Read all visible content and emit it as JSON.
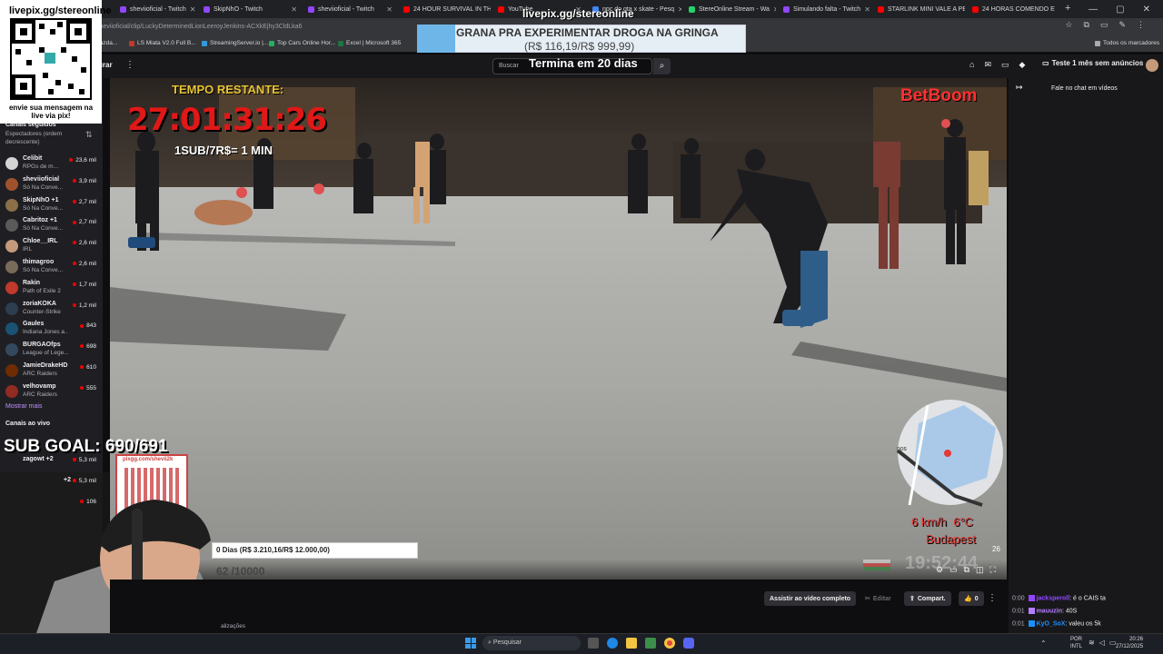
{
  "browser": {
    "tabs": [
      {
        "label": "sheviioficial - Twitch",
        "color": "#9147ff"
      },
      {
        "label": "SkipNhO - Twitch",
        "color": "#9147ff"
      },
      {
        "label": "sheviioficial - Twitch",
        "color": "#9147ff"
      },
      {
        "label": "24 HOUR SURVIVAL IN TH",
        "color": "#ff0000"
      },
      {
        "label": "YouTube",
        "color": "#ff0000"
      },
      {
        "label": "npc do gta x skate - Pesq",
        "color": "#4285f4"
      },
      {
        "label": "StereOnline Stream - Wa",
        "color": "#25d366"
      },
      {
        "label": "Simulando falta - Twitch",
        "color": "#9147ff"
      },
      {
        "label": "STARLINK MINI VALE A PE",
        "color": "#ff0000"
      },
      {
        "label": "24 HORAS COMENDO E",
        "color": "#ff0000"
      }
    ],
    "new_tab": "+",
    "url": "sheviioficial/clip/LuckyDeterminedLionLeeroyJenkins-ACXkEjhy3CldLka6",
    "bookmarks": [
      "fazda...",
      "LS Miata V2.0 Full B...",
      "StreamingServer.io |...",
      "Top Cars Online Hor...",
      "Excel | Microsoft 365"
    ],
    "all_bookmarks": "Todos os marcadores"
  },
  "twitch": {
    "nav_label": "urar",
    "search_placeholder": "Buscar",
    "promo": "Teste 1 mês sem anúncios",
    "sidebar": {
      "section_title": "Canais seguidos",
      "sort_label": "Espectadores (ordem decrescente)",
      "channels": [
        {
          "name": "Celibit",
          "game": "RPGs de m...",
          "viewers": "23,6 mil",
          "color": "#d4d4d4"
        },
        {
          "name": "sheviioficial",
          "game": "Só Na Conve...",
          "viewers": "3,9 mil",
          "color": "#a0522d"
        },
        {
          "name": "SkipNhO +1",
          "game": "Só Na Conve...",
          "viewers": "2,7 mil",
          "color": "#8b6f47"
        },
        {
          "name": "Cabritoz +1",
          "game": "Só Na Conve...",
          "viewers": "2,7 mil",
          "color": "#5a5a5a"
        },
        {
          "name": "Chloe__IRL",
          "game": "IRL",
          "viewers": "2,6 mil",
          "color": "#c49a7a"
        },
        {
          "name": "thimagroo",
          "game": "Só Na Conve...",
          "viewers": "2,6 mil",
          "color": "#7a6a5a"
        },
        {
          "name": "Rakin",
          "game": "Path of Exile 2",
          "viewers": "1,7 mil",
          "color": "#c0392b"
        },
        {
          "name": "zoriaKOKA",
          "game": "Counter-Strike",
          "viewers": "1,2 mil",
          "color": "#2c3e50"
        },
        {
          "name": "Gaules",
          "game": "Indiana Jones a...",
          "viewers": "843",
          "color": "#1a5276"
        },
        {
          "name": "BURGAOfps",
          "game": "League of Lege...",
          "viewers": "698",
          "color": "#34495e"
        },
        {
          "name": "JamieDrakeHD",
          "game": "ARC Raiders",
          "viewers": "610",
          "color": "#6e2c00"
        },
        {
          "name": "velhovamp",
          "game": "ARC Raiders",
          "viewers": "555",
          "color": "#922b21"
        }
      ],
      "show_more": "Mostrar mais",
      "live_title": "Canais ao vivo",
      "live_channels": [
        {
          "name": "zagowt +2",
          "viewers": "5,3 mil"
        },
        {
          "name": "+2",
          "viewers": "5,3 mil"
        },
        {
          "name": "",
          "viewers": "106"
        }
      ]
    },
    "chat_label": "Fale no chat em vídeos",
    "actions": {
      "watch_full": "Assistir ao vídeo completo",
      "edit": "Editar",
      "share": "Compart.",
      "likes": "0"
    },
    "below_text": "alizações",
    "chat": [
      {
        "time": "0:00",
        "user": "jacksperoll",
        "msg": ": é o CAIS ta",
        "color": "#9147ff"
      },
      {
        "time": "0:01",
        "user": "mauuzin",
        "msg": ": 40S",
        "color": "#b57dff"
      },
      {
        "time": "0:01",
        "user": "KyO_SoX",
        "msg": ": valeu os 5k",
        "color": "#1e90ff"
      }
    ]
  },
  "overlay": {
    "livepix_top": "livepix.gg/stereonline",
    "livepix_center": "livepix.gg/stereonline",
    "qr_caption": "envie sua mensagem na live via pix!",
    "goal_title": "GRANA PRA EXPERIMENTAR DROGA NA GRINGA",
    "goal_amount": "(R$ 116,19/R$ 999,99)",
    "goal_ends": "Termina em 20 dias",
    "timer_label": "TEMPO RESTANTE:",
    "timer_value": "27:01:31:26",
    "sub_rate": "1SUB/7R$= 1 MIN",
    "brand": "BetBoom",
    "sub_goal": "SUB GOAL: 690/691",
    "pix_link": "pixgg.com/shevii2k",
    "bottom_goal": "0 Dias (R$ 3.210,16/R$ 12.000,00)",
    "bottom_counter": "62 /10000",
    "speed": "6 km/h",
    "temp": "6°C",
    "city": "Budapest",
    "clock": "19:52:44",
    "clip_num": "26",
    "map_label": "DOS"
  },
  "taskbar": {
    "search": "Pesquisar",
    "lang1": "POR",
    "lang2": "INTL",
    "time": "20:26",
    "date": "27/12/2025"
  }
}
